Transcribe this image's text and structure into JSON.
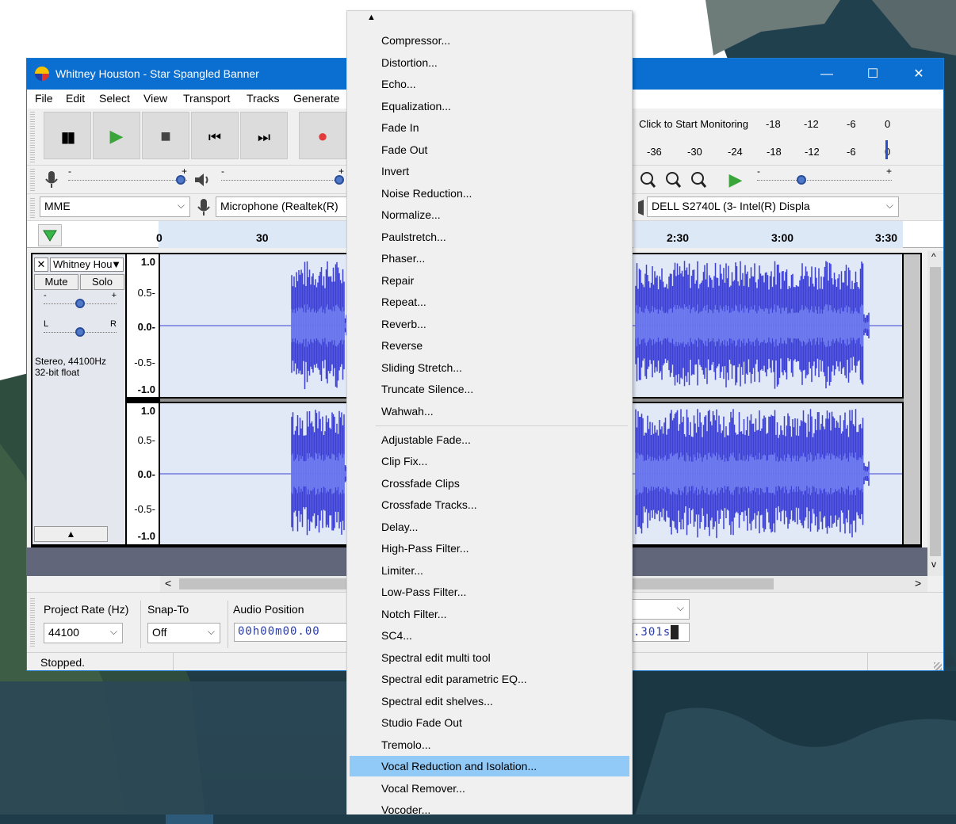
{
  "window": {
    "title": "Whitney Houston - Star Spangled Banner"
  },
  "window_controls": {
    "minimize": "—",
    "maximize": "☐",
    "close": "✕"
  },
  "menubar": [
    "File",
    "Edit",
    "Select",
    "View",
    "Transport",
    "Tracks",
    "Generate"
  ],
  "transport": {
    "pause": "▮▮",
    "play": "▶",
    "stop": "■",
    "skip_start": "⏮",
    "skip_end": "⏭",
    "record": "●"
  },
  "meters": {
    "click_to_monitor": "Click to Start Monitoring",
    "record_ticks": [
      "-18",
      "-12",
      "-6",
      "0"
    ],
    "play_ticks": [
      "-36",
      "-30",
      "-24",
      "-18",
      "-12",
      "-6",
      "0"
    ]
  },
  "sliders": {
    "record_volume": {
      "minus": "-",
      "plus": "+"
    },
    "playback_volume": {
      "minus": "-",
      "plus": "+"
    },
    "play_speed": {
      "minus": "-",
      "plus": "+"
    }
  },
  "device": {
    "host": "MME",
    "input": "Microphone (Realtek(R) ",
    "output": "DELL S2740L (3- Intel(R) Displa"
  },
  "ruler": {
    "ticks": [
      "0",
      "30",
      "2:30",
      "3:00",
      "3:30"
    ]
  },
  "track": {
    "name": "Whitney Hou",
    "mute": "Mute",
    "solo": "Solo",
    "gain_minus": "-",
    "gain_plus": "+",
    "pan_left": "L",
    "pan_right": "R",
    "info": "Stereo, 44100Hz\n32-bit float",
    "collapse": "▲"
  },
  "vruler": {
    "top": [
      "1.0",
      "0.5-",
      "0.0-",
      "-0.5-",
      "-1.0"
    ],
    "bottom": [
      "1.0",
      "0.5-",
      "0.0-",
      "-0.5-",
      "-1.0"
    ]
  },
  "scrollbars": {
    "left_arrow": "<",
    "right_arrow": ">",
    "up_arrow": "^",
    "down_arrow": "v"
  },
  "selection_toolbar": {
    "project_rate_label": "Project Rate (Hz)",
    "project_rate": "44100",
    "snap_label": "Snap-To",
    "snap": "Off",
    "audio_position_label": "Audio Position",
    "audio_position": "00h00m00.00",
    "end_value": ".301s"
  },
  "status": {
    "text": "Stopped."
  },
  "effects_menu": {
    "scroll_up": "▲",
    "group1": [
      "Compressor...",
      "Distortion...",
      "Echo...",
      "Equalization...",
      "Fade In",
      "Fade Out",
      "Invert",
      "Noise Reduction...",
      "Normalize...",
      "Paulstretch...",
      "Phaser...",
      "Repair",
      "Repeat...",
      "Reverb...",
      "Reverse",
      "Sliding Stretch...",
      "Truncate Silence...",
      "Wahwah..."
    ],
    "group2": [
      "Adjustable Fade...",
      "Clip Fix...",
      "Crossfade Clips",
      "Crossfade Tracks...",
      "Delay...",
      "High-Pass Filter...",
      "Limiter...",
      "Low-Pass Filter...",
      "Notch Filter...",
      "SC4...",
      "Spectral edit multi tool",
      "Spectral edit parametric EQ...",
      "Spectral edit shelves...",
      "Studio Fade Out",
      "Tremolo...",
      "Vocal Reduction and Isolation...",
      "Vocal Remover...",
      "Vocoder..."
    ],
    "highlighted": "Vocal Reduction and Isolation..."
  },
  "colors": {
    "title_bar": "#0a6fd0",
    "waveform": "#3b3fd6",
    "waveform_rms": "#6e7cf0",
    "menu_highlight": "#91c9f7",
    "play_green": "#3aa63a",
    "record_red": "#e23b3b"
  }
}
